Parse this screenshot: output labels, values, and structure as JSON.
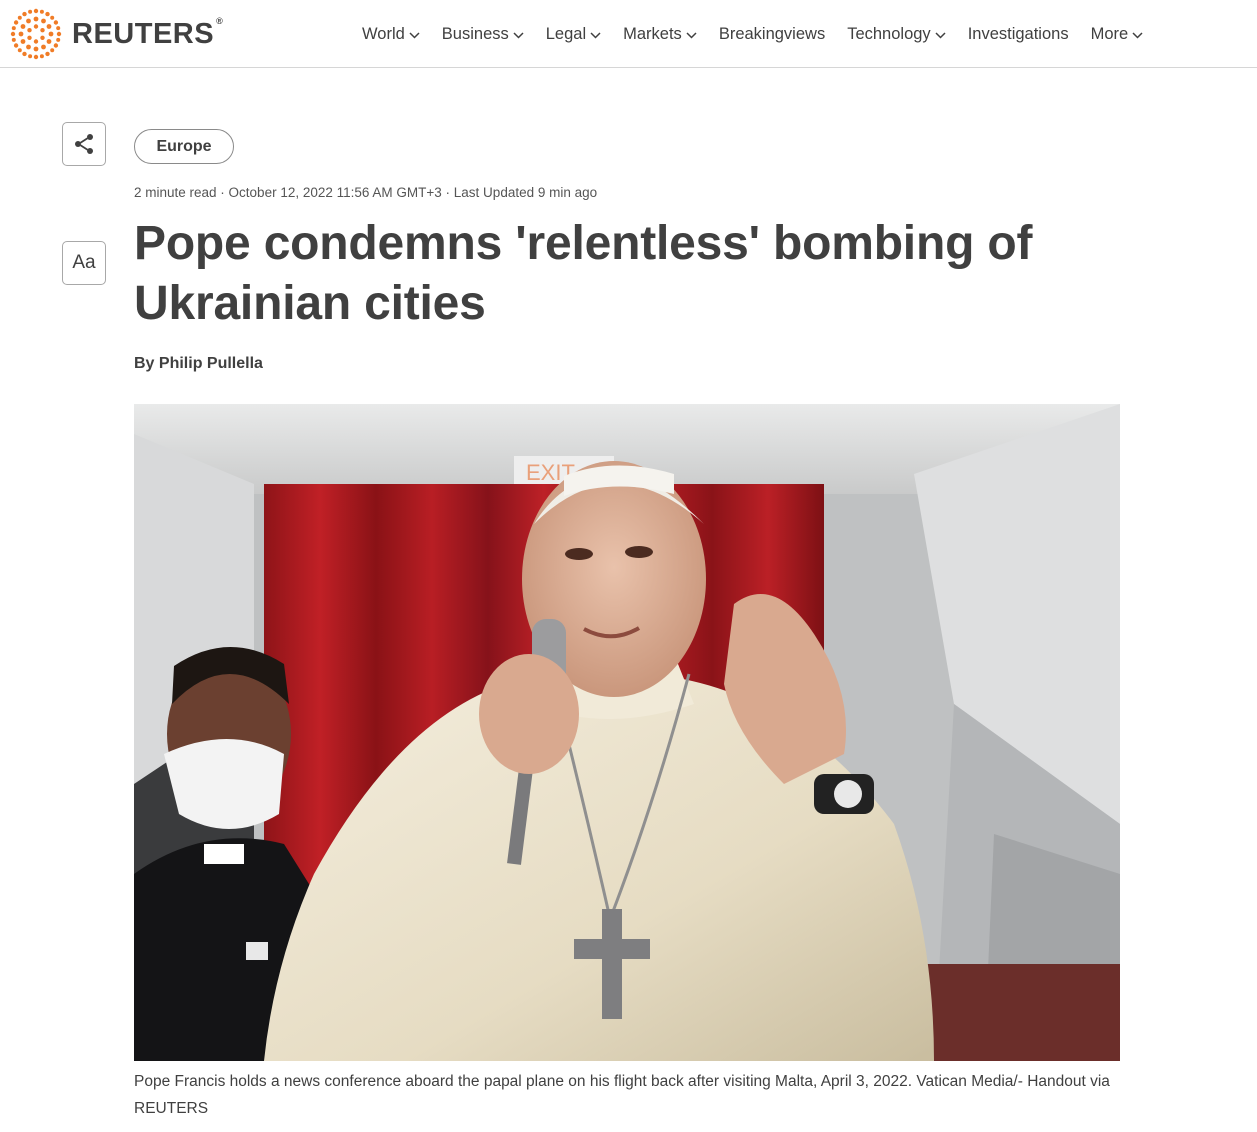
{
  "header": {
    "logo_text": "REUTERS",
    "logo_reg": "®",
    "nav": [
      {
        "label": "World",
        "has_dropdown": true
      },
      {
        "label": "Business",
        "has_dropdown": true
      },
      {
        "label": "Legal",
        "has_dropdown": true
      },
      {
        "label": "Markets",
        "has_dropdown": true
      },
      {
        "label": "Breakingviews",
        "has_dropdown": false
      },
      {
        "label": "Technology",
        "has_dropdown": true
      },
      {
        "label": "Investigations",
        "has_dropdown": false
      },
      {
        "label": "More",
        "has_dropdown": true
      }
    ]
  },
  "tools": {
    "share_icon": "share-icon",
    "text_size_label": "Aa"
  },
  "article": {
    "section": "Europe",
    "meta": "2 minute read · October 12, 2022 11:56 AM GMT+3 · Last Updated 9 min ago",
    "headline": "Pope condemns 'relentless' bombing of Ukrainian cities",
    "byline_prefix": "By",
    "author": "Philip Pullella",
    "photo_sign_text": "EXIT",
    "caption": "Pope Francis holds a news conference aboard the papal plane on his flight back after visiting Malta, April 3, 2022. Vatican Media/- Handout via REUTERS"
  },
  "colors": {
    "text": "#404040",
    "logo_orange": "#f07c27",
    "border": "#d6d6d6"
  }
}
